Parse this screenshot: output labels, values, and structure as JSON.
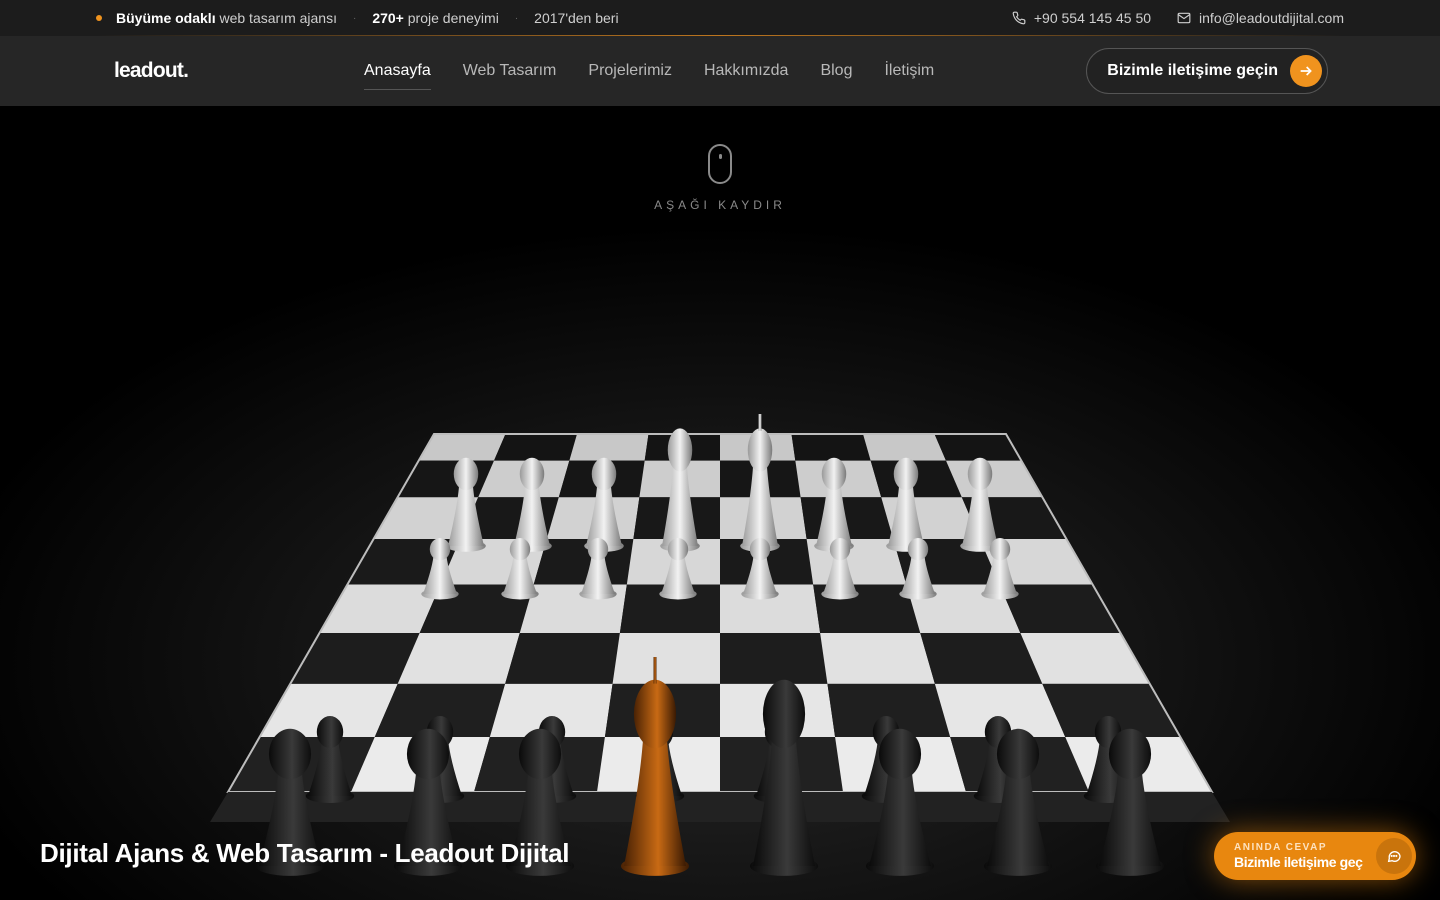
{
  "topbar": {
    "tag_bold": "Büyüme odaklı",
    "tag_rest": "web tasarım ajansı",
    "projects_bold": "270+",
    "projects_rest": "proje deneyimi",
    "since": "2017'den beri",
    "phone": "+90 554 145 45 50",
    "email": "info@leadoutdijital.com"
  },
  "nav": {
    "logo": "leadout.",
    "items": [
      "Anasayfa",
      "Web Tasarım",
      "Projelerimiz",
      "Hakkımızda",
      "Blog",
      "İletişim"
    ],
    "cta_label": "Bizimle iletişime geçin"
  },
  "hero": {
    "scroll_hint": "AŞAĞI KAYDIR",
    "title": "Dijital Ajans & Web Tasarım - Leadout Dijital"
  },
  "chat_widget": {
    "small": "ANINDA CEVAP",
    "big": "Bizimle iletişime geç"
  },
  "colors": {
    "accent": "#f0931e",
    "topbar_bg": "#1c1c1c",
    "nav_bg": "#262626"
  },
  "icons": [
    "phone-icon",
    "mail-icon",
    "arrow-right-icon",
    "mouse-icon",
    "chat-bubble-icon"
  ]
}
